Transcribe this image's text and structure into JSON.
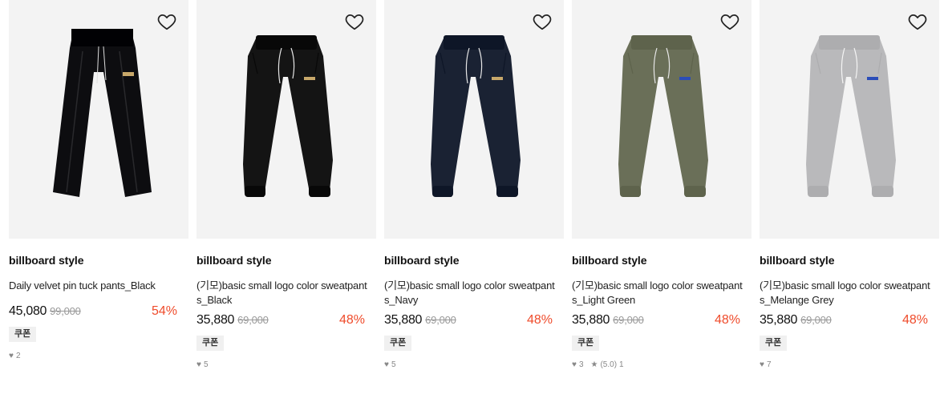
{
  "products": [
    {
      "brand": "billboard style",
      "name": "Daily velvet pin tuck pants_Black",
      "sale_price": "45,080",
      "original_price": "99,000",
      "discount": "54%",
      "coupon": "쿠폰",
      "likes": "2",
      "rating": "",
      "reviews": "",
      "color": "#0d0d10",
      "style": "velvet"
    },
    {
      "brand": "billboard style",
      "name": "(기모)basic small logo color sweatpants_Black",
      "sale_price": "35,880",
      "original_price": "69,000",
      "discount": "48%",
      "coupon": "쿠폰",
      "likes": "5",
      "rating": "",
      "reviews": "",
      "color": "#141414",
      "style": "jogger"
    },
    {
      "brand": "billboard style",
      "name": "(기모)basic small logo color sweatpants_Navy",
      "sale_price": "35,880",
      "original_price": "69,000",
      "discount": "48%",
      "coupon": "쿠폰",
      "likes": "5",
      "rating": "",
      "reviews": "",
      "color": "#1a2233",
      "style": "jogger"
    },
    {
      "brand": "billboard style",
      "name": "(기모)basic small logo color sweatpants_Light Green",
      "sale_price": "35,880",
      "original_price": "69,000",
      "discount": "48%",
      "coupon": "쿠폰",
      "likes": "3",
      "rating": "(5.0)",
      "reviews": "1",
      "color": "#6a6f58",
      "style": "jogger"
    },
    {
      "brand": "billboard style",
      "name": "(기모)basic small logo color sweatpants_Melange Grey",
      "sale_price": "35,880",
      "original_price": "69,000",
      "discount": "48%",
      "coupon": "쿠폰",
      "likes": "7",
      "rating": "",
      "reviews": "",
      "color": "#b9b9bb",
      "style": "jogger"
    }
  ],
  "colors": {
    "discount": "#ef4b2b",
    "image_bg": "#f3f3f3",
    "coupon_bg": "#f0f0f0"
  },
  "icons": {
    "wishlist": "heart-outline-icon",
    "likes": "heart-icon",
    "rating": "star-icon"
  }
}
